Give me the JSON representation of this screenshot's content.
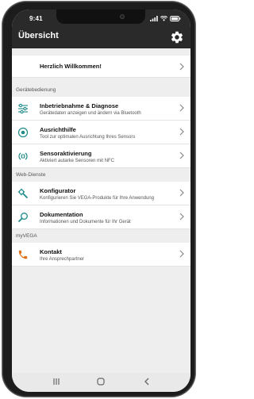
{
  "status_bar": {
    "time": "9:41"
  },
  "app_bar": {
    "title": "Übersicht",
    "settings_icon": "gear-icon"
  },
  "welcome": {
    "title": "Herzlich Willkommen!"
  },
  "sections": [
    {
      "header": "Gerätebedienung",
      "items": [
        {
          "title": "Inbetriebnahme & Diagnose",
          "subtitle": "Gerätedaten anzeigen und ändern via Bluetooth",
          "icon": "sliders-icon"
        },
        {
          "title": "Ausrichthilfe",
          "subtitle": "Tool zur optimalen Ausrichtung Ihres Sensors",
          "icon": "target-icon"
        },
        {
          "title": "Sensoraktivierung",
          "subtitle": "Aktiviert autarke Sensoren mit NFC",
          "icon": "nfc-icon"
        }
      ]
    },
    {
      "header": "Web-Dienste",
      "items": [
        {
          "title": "Konfigurator",
          "subtitle": "Konfigurieren Sie VEGA-Produkte für Ihre Anwendung",
          "icon": "configurator-icon"
        },
        {
          "title": "Dokumentation",
          "subtitle": "Informationen und Dokumente für Ihr Gerät",
          "icon": "magnifier-icon"
        }
      ]
    },
    {
      "header": "myVEGA",
      "items": [
        {
          "title": "Kontakt",
          "subtitle": "Ihre Ansprechpartner",
          "icon": "phone-icon"
        }
      ]
    }
  ],
  "colors": {
    "accent": "#1f8a8a",
    "contact": "#e0711a",
    "appbar": "#2a2a2a"
  }
}
